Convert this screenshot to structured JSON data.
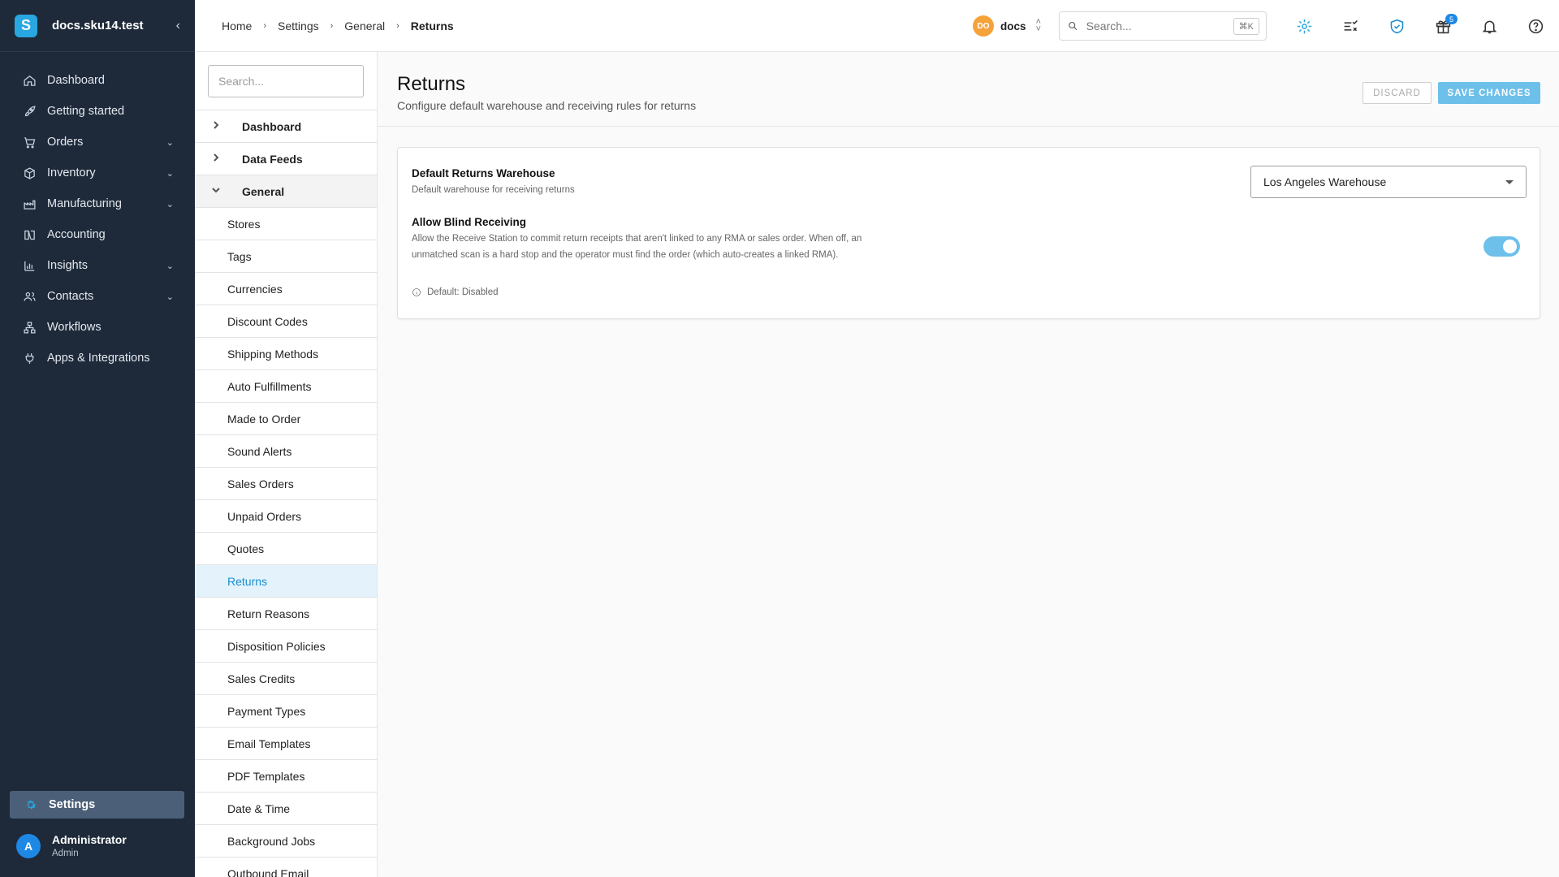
{
  "brand": {
    "name": "docs.sku14.test",
    "logo_letter": "S",
    "color": "#29a7e1"
  },
  "nav": {
    "items": [
      {
        "label": "Dashboard",
        "icon": "home-icon",
        "expandable": false
      },
      {
        "label": "Getting started",
        "icon": "rocket-icon",
        "expandable": false
      },
      {
        "label": "Orders",
        "icon": "cart-icon",
        "expandable": true
      },
      {
        "label": "Inventory",
        "icon": "box-icon",
        "expandable": true
      },
      {
        "label": "Manufacturing",
        "icon": "factory-icon",
        "expandable": true
      },
      {
        "label": "Accounting",
        "icon": "ledger-icon",
        "expandable": false
      },
      {
        "label": "Insights",
        "icon": "chart-icon",
        "expandable": true
      },
      {
        "label": "Contacts",
        "icon": "people-icon",
        "expandable": true
      },
      {
        "label": "Workflows",
        "icon": "workflow-icon",
        "expandable": false
      },
      {
        "label": "Apps & Integrations",
        "icon": "plug-icon",
        "expandable": false
      }
    ],
    "settings_label": "Settings"
  },
  "user": {
    "initial": "A",
    "name": "Administrator",
    "role": "Admin"
  },
  "breadcrumb": [
    "Home",
    "Settings",
    "General",
    "Returns"
  ],
  "topbar": {
    "org_initials": "DO",
    "org_name": "docs",
    "search_placeholder": "Search...",
    "search_shortcut": "⌘K",
    "gift_badge": "5"
  },
  "settings_nav": {
    "search_placeholder": "Search...",
    "groups": [
      {
        "label": "Dashboard",
        "open": false
      },
      {
        "label": "Data Feeds",
        "open": false
      },
      {
        "label": "General",
        "open": true
      }
    ],
    "items": [
      "Stores",
      "Tags",
      "Currencies",
      "Discount Codes",
      "Shipping Methods",
      "Auto Fulfillments",
      "Made to Order",
      "Sound Alerts",
      "Sales Orders",
      "Unpaid Orders",
      "Quotes",
      "Returns",
      "Return Reasons",
      "Disposition Policies",
      "Sales Credits",
      "Payment Types",
      "Email Templates",
      "PDF Templates",
      "Date & Time",
      "Background Jobs",
      "Outbound Email"
    ],
    "active_item": "Returns"
  },
  "page": {
    "title": "Returns",
    "subtitle": "Configure default warehouse and receiving rules for returns",
    "discard_label": "DISCARD",
    "save_label": "SAVE CHANGES"
  },
  "settings": {
    "warehouse": {
      "title": "Default Returns Warehouse",
      "description": "Default warehouse for receiving returns",
      "value": "Los Angeles Warehouse"
    },
    "blind_receiving": {
      "title": "Allow Blind Receiving",
      "description": "Allow the Receive Station to commit return receipts that aren't linked to any RMA or sales order. When off, an unmatched scan is a hard stop and the operator must find the order (which auto-creates a linked RMA).",
      "default_note": "Default: Disabled",
      "enabled": true
    }
  },
  "colors": {
    "accent": "#29a7e1",
    "sidebar_bg": "#1e2a3a",
    "active_bg": "#e3f2fb",
    "toggle_on": "#6cc0ea",
    "org_badge": "#f5a23b"
  }
}
